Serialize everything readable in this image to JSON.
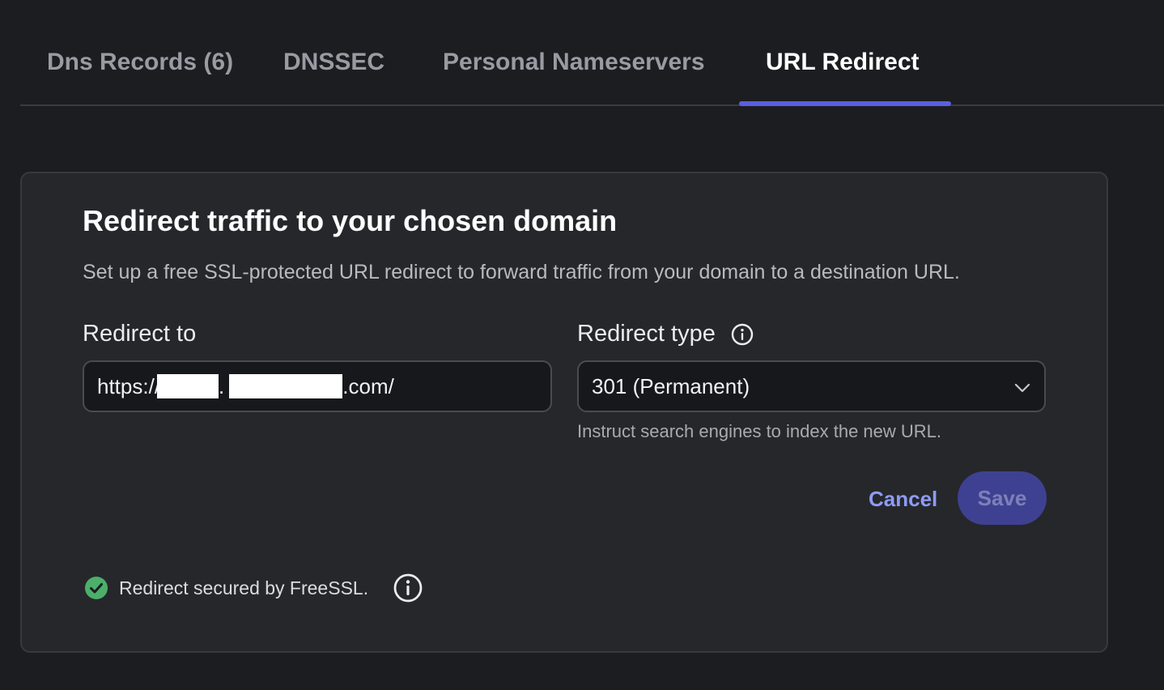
{
  "tabs": [
    {
      "label": "Dns Records (6)"
    },
    {
      "label": "DNSSEC"
    },
    {
      "label": "Personal Nameservers"
    },
    {
      "label": "URL Redirect",
      "active": true
    }
  ],
  "card": {
    "title": "Redirect traffic to your chosen domain",
    "description": "Set up a free SSL-protected URL redirect to forward traffic from your domain to a destination URL."
  },
  "redirect_to": {
    "label": "Redirect to",
    "value_prefix": "https://",
    "value_mid": ".",
    "value_suffix": ".com/"
  },
  "redirect_type": {
    "label": "Redirect type",
    "selected": "301 (Permanent)",
    "helper": "Instruct search engines to index the new URL."
  },
  "actions": {
    "cancel_label": "Cancel",
    "save_label": "Save"
  },
  "ssl": {
    "status_text": "Redirect secured by FreeSSL."
  },
  "colors": {
    "accent": "#5a5fe0",
    "link": "#8e9bf5",
    "success": "#4caf6a",
    "background": "#1c1d21",
    "card": "#26272b"
  },
  "icons": [
    "info-icon",
    "chevron-down-icon",
    "check-circle-icon"
  ]
}
